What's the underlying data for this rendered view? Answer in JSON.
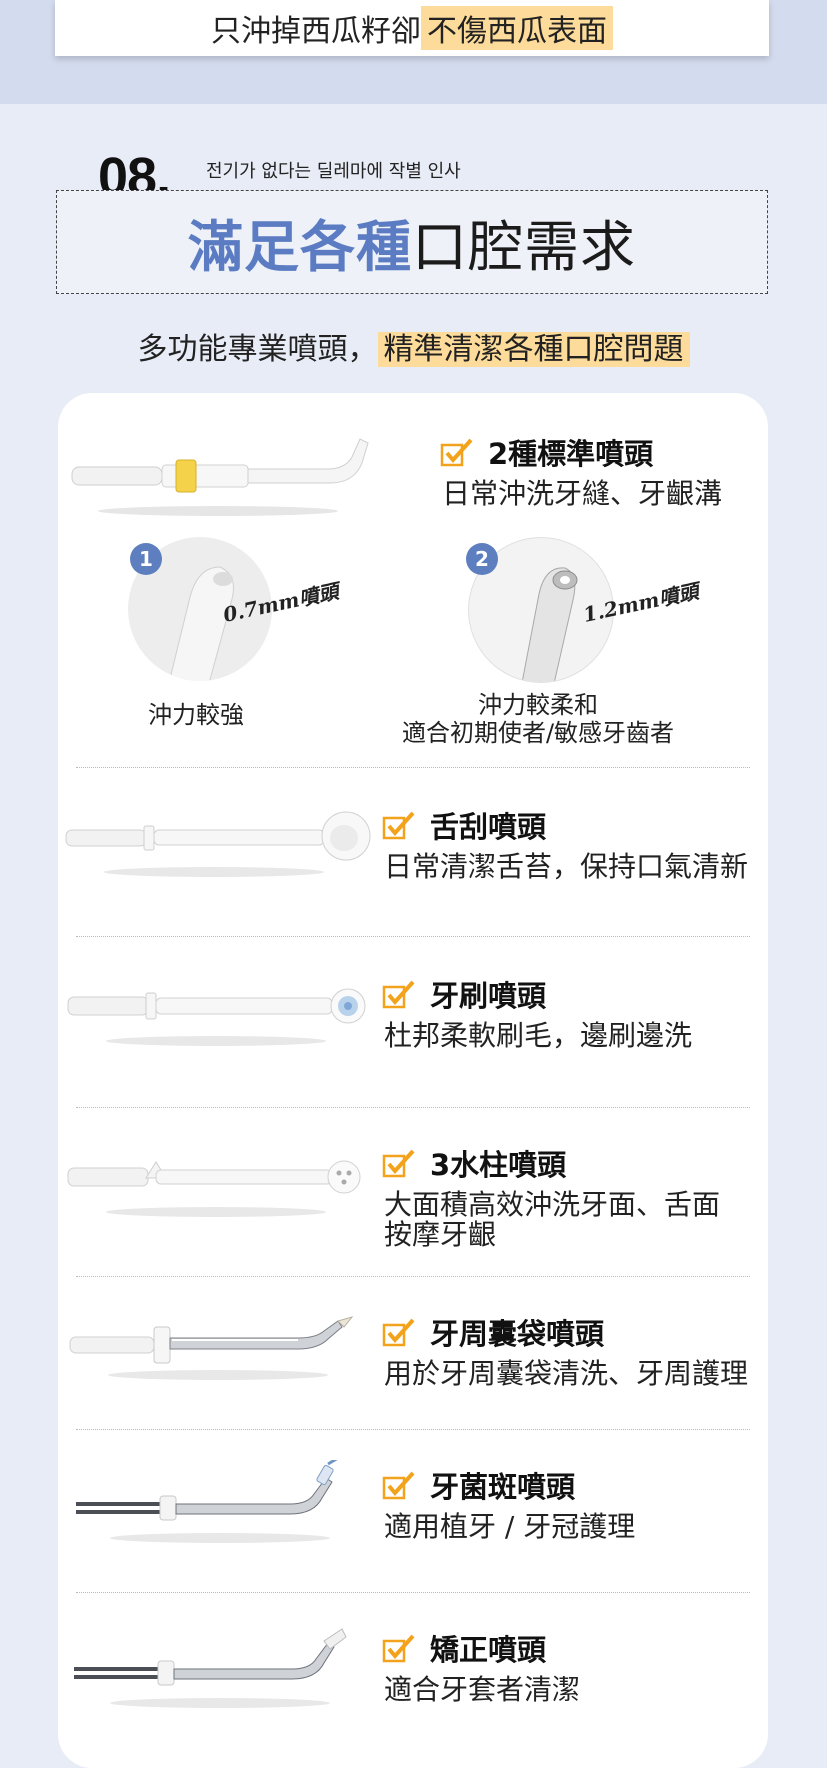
{
  "header": {
    "text_plain": "只沖掉西瓜籽卻",
    "text_highlight": "不傷西瓜表面"
  },
  "section": {
    "number": "08.",
    "korean_caption": "전기가 없다는 딜레마에 작별 인사",
    "title_blue": "滿足各種",
    "title_dark": "口腔需求",
    "subtitle_plain": "多功能專業噴頭，",
    "subtitle_highlight": "精準清潔各種口腔問題"
  },
  "colors": {
    "accent_blue": "#5b7cc2",
    "highlight": "#fddb9a",
    "check_orange": "#f2a21b"
  },
  "standard": {
    "title": "2種標準噴頭",
    "desc": "日常沖洗牙縫、牙齦溝",
    "options": [
      {
        "badge": "1",
        "size_label": "0.7mm噴頭",
        "caption_line1": "沖力較強",
        "caption_line2": ""
      },
      {
        "badge": "2",
        "size_label": "1.2mm噴頭",
        "caption_line1": "沖力較柔和",
        "caption_line2": "適合初期使者/敏感牙齒者"
      }
    ]
  },
  "items": [
    {
      "title": "舌刮噴頭",
      "desc_lines": [
        "日常清潔舌苔，保持口氣清新"
      ],
      "icon": "tongue-scraper-nozzle"
    },
    {
      "title": "牙刷噴頭",
      "desc_lines": [
        "杜邦柔軟刷毛，邊刷邊洗"
      ],
      "icon": "toothbrush-nozzle"
    },
    {
      "title": "3水柱噴頭",
      "desc_lines": [
        "大面積高效沖洗牙面、舌面",
        "按摩牙齦"
      ],
      "icon": "triple-jet-nozzle"
    },
    {
      "title": "牙周囊袋噴頭",
      "desc_lines": [
        "用於牙周囊袋清洗、牙周護理"
      ],
      "icon": "periodontal-nozzle"
    },
    {
      "title": "牙菌斑噴頭",
      "desc_lines": [
        "適用植牙 / 牙冠護理"
      ],
      "icon": "plaque-nozzle"
    },
    {
      "title": "矯正噴頭",
      "desc_lines": [
        "適合牙套者清潔"
      ],
      "icon": "orthodontic-nozzle"
    }
  ]
}
